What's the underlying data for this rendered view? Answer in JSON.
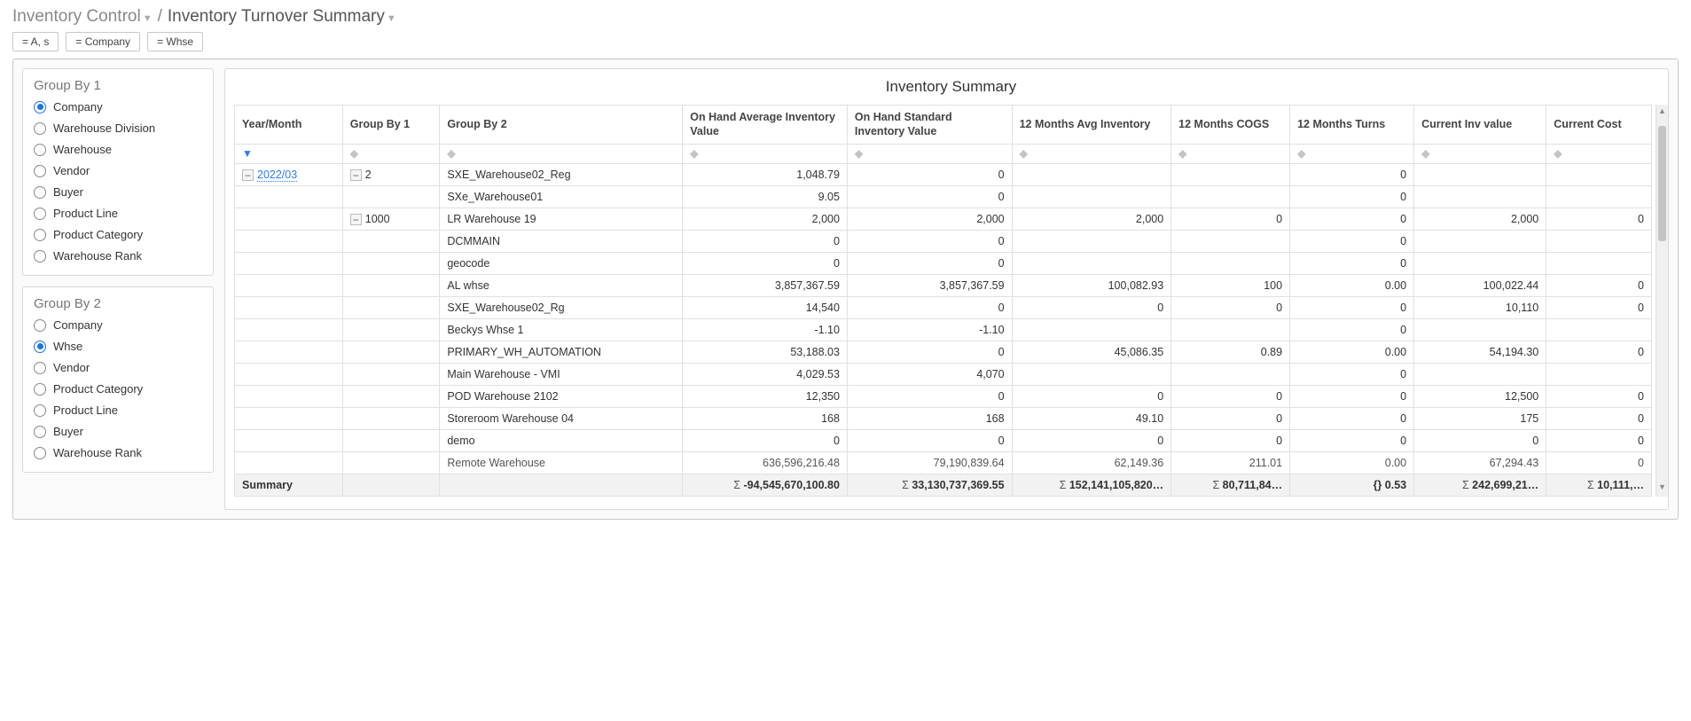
{
  "breadcrumb": {
    "parent": "Inventory Control",
    "current": "Inventory Turnover Summary"
  },
  "filters": [
    {
      "label": "= A, s"
    },
    {
      "label": "= Company"
    },
    {
      "label": "= Whse"
    }
  ],
  "groupBy1": {
    "title": "Group By 1",
    "selected": "Company",
    "options": [
      "Company",
      "Warehouse Division",
      "Warehouse",
      "Vendor",
      "Buyer",
      "Product Line",
      "Product Category",
      "Warehouse Rank"
    ]
  },
  "groupBy2": {
    "title": "Group By 2",
    "selected": "Whse",
    "options": [
      "Company",
      "Whse",
      "Vendor",
      "Product Category",
      "Product Line",
      "Buyer",
      "Warehouse Rank"
    ]
  },
  "chartTitle": "Inventory Summary",
  "columns": [
    "Year/Month",
    "Group By 1",
    "Group By 2",
    "On Hand Average Inventory Value",
    "On Hand Standard Inventory Value",
    "12 Months Avg Inventory",
    "12 Months COGS",
    "12 Months Turns",
    "Current Inv value",
    "Current Cost"
  ],
  "rows": [
    {
      "year": "2022/03",
      "g1": "2",
      "g2": "SXE_Warehouse02_Reg",
      "avg": "1,048.79",
      "std": "0",
      "m12avg": "",
      "cogs": "",
      "turns": "0",
      "curv": "",
      "cost": ""
    },
    {
      "year": "",
      "g1": "",
      "g2": "SXe_Warehouse01",
      "avg": "9.05",
      "std": "0",
      "m12avg": "",
      "cogs": "",
      "turns": "0",
      "curv": "",
      "cost": ""
    },
    {
      "year": "",
      "g1": "1000",
      "g2": "LR Warehouse 19",
      "avg": "2,000",
      "std": "2,000",
      "m12avg": "2,000",
      "cogs": "0",
      "turns": "0",
      "curv": "2,000",
      "cost": "0"
    },
    {
      "year": "",
      "g1": "",
      "g2": "DCMMAIN",
      "avg": "0",
      "std": "0",
      "m12avg": "",
      "cogs": "",
      "turns": "0",
      "curv": "",
      "cost": ""
    },
    {
      "year": "",
      "g1": "",
      "g2": "geocode",
      "avg": "0",
      "std": "0",
      "m12avg": "",
      "cogs": "",
      "turns": "0",
      "curv": "",
      "cost": ""
    },
    {
      "year": "",
      "g1": "",
      "g2": "AL whse",
      "avg": "3,857,367.59",
      "std": "3,857,367.59",
      "m12avg": "100,082.93",
      "cogs": "100",
      "turns": "0.00",
      "curv": "100,022.44",
      "cost": "0"
    },
    {
      "year": "",
      "g1": "",
      "g2": "SXE_Warehouse02_Rg",
      "avg": "14,540",
      "std": "0",
      "m12avg": "0",
      "cogs": "0",
      "turns": "0",
      "curv": "10,110",
      "cost": "0"
    },
    {
      "year": "",
      "g1": "",
      "g2": "Beckys Whse 1",
      "avg": "-1.10",
      "std": "-1.10",
      "m12avg": "",
      "cogs": "",
      "turns": "0",
      "curv": "",
      "cost": ""
    },
    {
      "year": "",
      "g1": "",
      "g2": "PRIMARY_WH_AUTOMATION",
      "avg": "53,188.03",
      "std": "0",
      "m12avg": "45,086.35",
      "cogs": "0.89",
      "turns": "0.00",
      "curv": "54,194.30",
      "cost": "0"
    },
    {
      "year": "",
      "g1": "",
      "g2": "Main Warehouse - VMI",
      "avg": "4,029.53",
      "std": "4,070",
      "m12avg": "",
      "cogs": "",
      "turns": "0",
      "curv": "",
      "cost": ""
    },
    {
      "year": "",
      "g1": "",
      "g2": "POD Warehouse 2102",
      "avg": "12,350",
      "std": "0",
      "m12avg": "0",
      "cogs": "0",
      "turns": "0",
      "curv": "12,500",
      "cost": "0"
    },
    {
      "year": "",
      "g1": "",
      "g2": "Storeroom Warehouse 04",
      "avg": "168",
      "std": "168",
      "m12avg": "49.10",
      "cogs": "0",
      "turns": "0",
      "curv": "175",
      "cost": "0"
    },
    {
      "year": "",
      "g1": "",
      "g2": "demo",
      "avg": "0",
      "std": "0",
      "m12avg": "0",
      "cogs": "0",
      "turns": "0",
      "curv": "0",
      "cost": "0"
    },
    {
      "year": "",
      "g1": "",
      "g2": "Remote Warehouse",
      "avg": "636,596,216.48",
      "std": "79,190,839.64",
      "m12avg": "62,149.36",
      "cogs": "211.01",
      "turns": "0.00",
      "curv": "67,294.43",
      "cost": "0"
    }
  ],
  "summary": {
    "label": "Summary",
    "avg": "-94,545,670,100.80",
    "std": "33,130,737,369.55",
    "m12avg": "152,141,105,820…",
    "cogs": "80,711,84…",
    "turns": "{}           0.53",
    "curv": "242,699,21…",
    "cost": "10,111,…"
  }
}
